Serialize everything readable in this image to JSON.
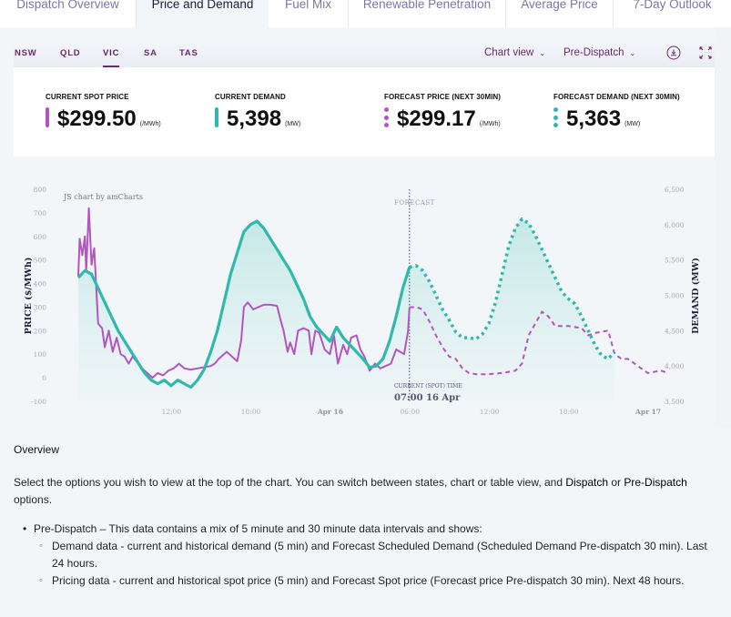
{
  "tabs": [
    {
      "label": "Dispatch Overview",
      "active": false
    },
    {
      "label": "Price and Demand",
      "active": true
    },
    {
      "label": "Fuel Mix",
      "active": false
    },
    {
      "label": "Renewable Penetration",
      "active": false
    },
    {
      "label": "Average Price",
      "active": false
    },
    {
      "label": "7-Day Outlook",
      "active": false
    }
  ],
  "regions": [
    {
      "label": "NSW",
      "active": false
    },
    {
      "label": "QLD",
      "active": false
    },
    {
      "label": "VIC",
      "active": true
    },
    {
      "label": "SA",
      "active": false
    },
    {
      "label": "TAS",
      "active": false
    }
  ],
  "toolbar": {
    "view_select": "Chart view",
    "dispatch_select": "Pre-Dispatch",
    "download_icon": "download-icon",
    "fullscreen_icon": "fullscreen-icon"
  },
  "stats": [
    {
      "label": "CURRENT SPOT PRICE",
      "value": "$299.50",
      "unit": "(/MWh)",
      "marker": "solid",
      "color": "#b355c0"
    },
    {
      "label": "CURRENT DEMAND",
      "value": "5,398",
      "unit": "(MW)",
      "marker": "solid",
      "color": "#2fb8ac"
    },
    {
      "label": "FORECAST PRICE (NEXT 30MIN)",
      "value": "$299.17",
      "unit": "(/MWh)",
      "marker": "dotted",
      "color": "#b355c0"
    },
    {
      "label": "FORECAST DEMAND (NEXT 30MIN)",
      "value": "5,363",
      "unit": "(MW)",
      "marker": "dotted",
      "color": "#2fb8ac"
    }
  ],
  "chart_data": {
    "type": "line",
    "credit": "JS chart by amCharts",
    "forecast_label": "FORECAST",
    "current_time_label": "CURRENT (SPOT) TIME",
    "current_time_value": "07:00 16 Apr",
    "current_time_hours": 25,
    "x_unit": "hours since 06:00 Apr 15",
    "x_range": [
      0,
      47
    ],
    "x_ticks": [
      {
        "label": "12:00",
        "h": 6,
        "bold": false
      },
      {
        "label": "18:00",
        "h": 12,
        "bold": false
      },
      {
        "label": "Apr 16",
        "h": 18,
        "bold": true
      },
      {
        "label": "06:00",
        "h": 24,
        "bold": false
      },
      {
        "label": "12:00",
        "h": 30,
        "bold": false
      },
      {
        "label": "18:00",
        "h": 36,
        "bold": false
      },
      {
        "label": "Apr 17",
        "h": 42,
        "bold": true
      }
    ],
    "left_axis": {
      "label": "PRICE ($/MWh)",
      "range": [
        -100,
        800
      ],
      "ticks": [
        800,
        700,
        600,
        500,
        400,
        300,
        200,
        100,
        0,
        -100
      ]
    },
    "right_axis": {
      "label": "DEMAND (MW)",
      "range": [
        3500,
        6500
      ],
      "ticks": [
        "6,500",
        "6,000",
        "5,500",
        "5,000",
        "4,500",
        "4,000",
        "3,500"
      ],
      "tick_values": [
        6500,
        6000,
        5500,
        5000,
        4500,
        4000,
        3500
      ]
    },
    "colors": {
      "price": "#b355c0",
      "demand": "#2fb8ac",
      "fill": "#cfeceb"
    },
    "series": [
      {
        "name": "Price (actual)",
        "axis": "left",
        "style": "solid",
        "points": [
          [
            0,
            430
          ],
          [
            0.1,
            590
          ],
          [
            0.3,
            520
          ],
          [
            0.5,
            600
          ],
          [
            0.6,
            450
          ],
          [
            0.8,
            720
          ],
          [
            1.0,
            480
          ],
          [
            1.2,
            550
          ],
          [
            1.5,
            230
          ],
          [
            1.8,
            210
          ],
          [
            2.0,
            130
          ],
          [
            2.3,
            200
          ],
          [
            2.6,
            110
          ],
          [
            2.9,
            170
          ],
          [
            3.2,
            100
          ],
          [
            3.5,
            90
          ],
          [
            3.8,
            60
          ],
          [
            4.1,
            90
          ],
          [
            4.4,
            70
          ],
          [
            4.8,
            40
          ],
          [
            5.2,
            20
          ],
          [
            5.6,
            0
          ],
          [
            6.0,
            20
          ],
          [
            6.4,
            10
          ],
          [
            6.8,
            30
          ],
          [
            7.2,
            40
          ],
          [
            7.6,
            60
          ],
          [
            8.0,
            40
          ],
          [
            8.5,
            35
          ],
          [
            9.0,
            40
          ],
          [
            9.5,
            45
          ],
          [
            10.0,
            50
          ],
          [
            10.3,
            60
          ],
          [
            10.6,
            80
          ],
          [
            10.9,
            95
          ],
          [
            11.2,
            110
          ],
          [
            11.6,
            90
          ],
          [
            12.0,
            70
          ],
          [
            12.3,
            160
          ],
          [
            12.5,
            300
          ],
          [
            12.8,
            320
          ],
          [
            13.2,
            290
          ],
          [
            13.6,
            300
          ],
          [
            14.0,
            310
          ],
          [
            14.5,
            310
          ],
          [
            15.0,
            305
          ],
          [
            15.3,
            240
          ],
          [
            15.5,
            200
          ],
          [
            15.8,
            110
          ],
          [
            16.0,
            150
          ],
          [
            16.3,
            100
          ],
          [
            16.6,
            200
          ],
          [
            17.0,
            210
          ],
          [
            17.4,
            200
          ],
          [
            17.6,
            100
          ],
          [
            17.9,
            200
          ],
          [
            18.2,
            190
          ],
          [
            18.6,
            120
          ],
          [
            19.0,
            100
          ],
          [
            19.3,
            180
          ],
          [
            19.6,
            60
          ],
          [
            20.0,
            140
          ],
          [
            20.3,
            100
          ],
          [
            20.6,
            170
          ],
          [
            21.0,
            180
          ],
          [
            21.3,
            120
          ],
          [
            21.6,
            90
          ],
          [
            22.0,
            30
          ],
          [
            22.4,
            60
          ],
          [
            22.8,
            40
          ],
          [
            23.2,
            50
          ],
          [
            23.6,
            60
          ],
          [
            24.0,
            120
          ],
          [
            24.3,
            110
          ],
          [
            24.6,
            100
          ],
          [
            24.9,
            200
          ],
          [
            25.0,
            299.5
          ]
        ]
      },
      {
        "name": "Demand (actual)",
        "axis": "right",
        "style": "solid",
        "points": [
          [
            0,
            5250
          ],
          [
            0.5,
            5350
          ],
          [
            1.0,
            5300
          ],
          [
            1.5,
            5100
          ],
          [
            2.0,
            4900
          ],
          [
            2.5,
            4700
          ],
          [
            3.0,
            4500
          ],
          [
            3.5,
            4350
          ],
          [
            4.0,
            4200
          ],
          [
            4.5,
            4050
          ],
          [
            5.0,
            3900
          ],
          [
            5.5,
            3800
          ],
          [
            6.0,
            3750
          ],
          [
            6.5,
            3800
          ],
          [
            7.0,
            3720
          ],
          [
            7.5,
            3800
          ],
          [
            8.0,
            3750
          ],
          [
            8.5,
            3700
          ],
          [
            9.0,
            3800
          ],
          [
            9.5,
            3950
          ],
          [
            10.0,
            4200
          ],
          [
            10.5,
            4500
          ],
          [
            11.0,
            4900
          ],
          [
            11.5,
            5300
          ],
          [
            12.0,
            5600
          ],
          [
            12.5,
            5900
          ],
          [
            13.0,
            6000
          ],
          [
            13.5,
            6050
          ],
          [
            14.0,
            5950
          ],
          [
            14.5,
            5800
          ],
          [
            15.0,
            5650
          ],
          [
            15.5,
            5500
          ],
          [
            16.0,
            5350
          ],
          [
            16.5,
            5150
          ],
          [
            17.0,
            4950
          ],
          [
            17.5,
            4700
          ],
          [
            18.0,
            4550
          ],
          [
            18.5,
            4450
          ],
          [
            19.0,
            4350
          ],
          [
            19.5,
            4550
          ],
          [
            20.0,
            4400
          ],
          [
            20.5,
            4300
          ],
          [
            21.0,
            4200
          ],
          [
            21.5,
            4100
          ],
          [
            22.0,
            3980
          ],
          [
            22.5,
            4000
          ],
          [
            23.0,
            4100
          ],
          [
            23.5,
            4350
          ],
          [
            24.0,
            4700
          ],
          [
            24.5,
            5100
          ],
          [
            25.0,
            5398
          ]
        ]
      },
      {
        "name": "Price (forecast)",
        "axis": "left",
        "style": "dashed",
        "points": [
          [
            25.0,
            299.5
          ],
          [
            25.5,
            300
          ],
          [
            26.0,
            290
          ],
          [
            26.5,
            240
          ],
          [
            27.0,
            180
          ],
          [
            27.5,
            130
          ],
          [
            28.0,
            90
          ],
          [
            28.5,
            80
          ],
          [
            29.0,
            40
          ],
          [
            29.5,
            20
          ],
          [
            30.0,
            15
          ],
          [
            31.0,
            15
          ],
          [
            32.0,
            20
          ],
          [
            33.0,
            30
          ],
          [
            33.5,
            60
          ],
          [
            34.0,
            180
          ],
          [
            34.5,
            230
          ],
          [
            35.0,
            280
          ],
          [
            35.5,
            260
          ],
          [
            36.0,
            220
          ],
          [
            37.0,
            220
          ],
          [
            38.0,
            210
          ],
          [
            38.5,
            180
          ],
          [
            39.0,
            190
          ],
          [
            40.0,
            200
          ],
          [
            40.5,
            100
          ],
          [
            41.0,
            80
          ],
          [
            41.5,
            80
          ],
          [
            42.0,
            60
          ],
          [
            43.0,
            20
          ],
          [
            44.0,
            30
          ],
          [
            44.5,
            20
          ]
        ]
      },
      {
        "name": "Demand (forecast)",
        "axis": "right",
        "style": "dotted",
        "points": [
          [
            25.0,
            5398
          ],
          [
            25.5,
            5420
          ],
          [
            26.0,
            5350
          ],
          [
            26.5,
            5200
          ],
          [
            27.0,
            5000
          ],
          [
            27.5,
            4800
          ],
          [
            28.0,
            4650
          ],
          [
            28.5,
            4480
          ],
          [
            29.0,
            4400
          ],
          [
            29.5,
            4400
          ],
          [
            30.0,
            4380
          ],
          [
            30.5,
            4450
          ],
          [
            31.0,
            4600
          ],
          [
            31.5,
            4900
          ],
          [
            32.0,
            5300
          ],
          [
            32.5,
            5700
          ],
          [
            33.0,
            5950
          ],
          [
            33.5,
            6080
          ],
          [
            34.0,
            6020
          ],
          [
            34.5,
            5850
          ],
          [
            35.0,
            5650
          ],
          [
            35.5,
            5450
          ],
          [
            36.0,
            5250
          ],
          [
            36.5,
            5050
          ],
          [
            37.0,
            4950
          ],
          [
            37.5,
            4880
          ],
          [
            38.0,
            4700
          ],
          [
            38.5,
            4500
          ],
          [
            39.0,
            4300
          ],
          [
            39.5,
            4150
          ],
          [
            40.0,
            4100
          ],
          [
            40.5,
            4200
          ]
        ]
      }
    ]
  },
  "overview": {
    "title": "Overview",
    "intro_1": "Select the options you wish to view at the top of the chart. You can switch between states, chart or table view, and ",
    "intro_b1": "Dispatch",
    "intro_2": " or ",
    "intro_b2": "Pre-Dispatch",
    "intro_3": " options.",
    "bullet": "Pre-Dispatch – This data contains a mix of 5 minute and 30 minute data intervals and shows:",
    "sub_bullets": [
      "Demand data - current and historical demand (5 min) and Forecast Scheduled Demand (Scheduled Demand Pre-dispatch 30 min). Last 24 hours.",
      "Pricing data - current and historical spot price (5 min) and Forecast Spot price (Forecast price Pre-dispatch 30 min). Next 48 hours."
    ]
  }
}
